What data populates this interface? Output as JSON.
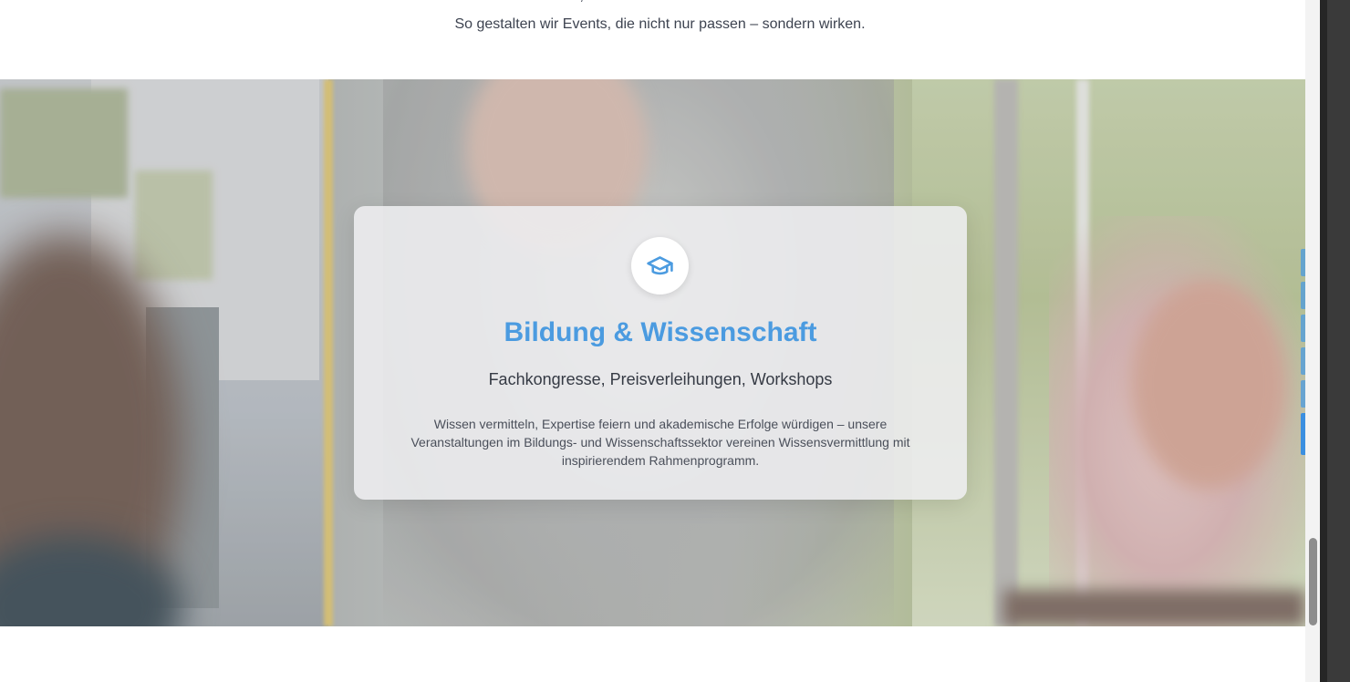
{
  "intro": {
    "line1": "wir verstehen, worauf es in Ihrer Branche ankommt.",
    "line2": "So gestalten wir Events, die nicht nur passen – sondern wirken."
  },
  "card": {
    "icon": "graduation-cap-icon",
    "title": "Bildung & Wissenschaft",
    "subtitle": "Fachkongresse, Preisverleihungen, Workshops",
    "body": "Wissen vermitteln, Expertise feiern und akademische Erfolge würdigen – unsere Veranstaltungen im Bildungs- und Wissenschaftssektor vereinen Wissensvermittlung mit inspirierendem Rahmenprogramm."
  },
  "colors": {
    "accent": "#4b9be0",
    "text_dark": "#353a44",
    "text_body": "#4a4f5a"
  },
  "section_nav": {
    "count": 6,
    "active_index": 5
  }
}
